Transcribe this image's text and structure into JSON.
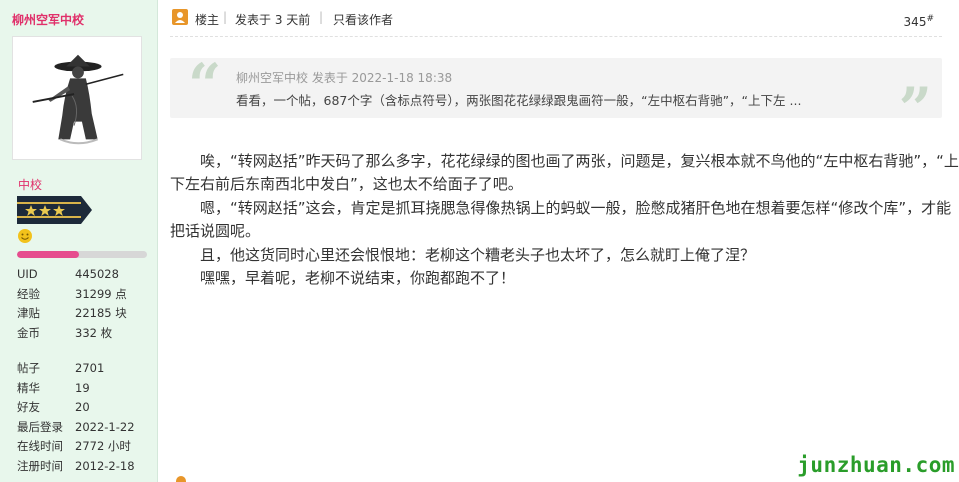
{
  "user": {
    "name": "柳州空军中校",
    "rank": "中校",
    "level_progress_percent": 48,
    "stats_group1": [
      {
        "label": "UID",
        "value": "445028"
      },
      {
        "label": "经验",
        "value": "31299 点"
      },
      {
        "label": "津贴",
        "value": "22185 块"
      },
      {
        "label": "金币",
        "value": "332 枚"
      }
    ],
    "stats_group2": [
      {
        "label": "帖子",
        "value": "2701"
      },
      {
        "label": "精华",
        "value": "19"
      },
      {
        "label": "好友",
        "value": "20"
      },
      {
        "label": "最后登录",
        "value": "2022-1-22"
      },
      {
        "label": "在线时间",
        "value": "2772 小时"
      },
      {
        "label": "注册时间",
        "value": "2012-2-18"
      }
    ]
  },
  "post": {
    "op_label": "楼主",
    "sep": "|",
    "time_label": "发表于 3 天前",
    "author_only_label": "只看该作者",
    "floor": "345",
    "floor_sup": "#",
    "quote": {
      "meta": "柳州空军中校 发表于 2022-1-18 18:38",
      "text": "看看，一个帖，687个字（含标点符号），两张图花花绿绿跟鬼画符一般，“左中枢右背驰”，“上下左 ...",
      "open_mark": "“",
      "close_mark": "”"
    },
    "paragraphs": [
      "唉，“转网赵括”昨天码了那么多字，花花绿绿的图也画了两张，问题是，复兴根本就不鸟他的“左中枢右背驰”，“上下左右前后东南西北中发白”，这也太不给面子了吧。",
      "嗯，“转网赵括”这会，肯定是抓耳挠腮急得像热锅上的蚂蚁一般，脸憋成猪肝色地在想着要怎样“修改个库”，才能把话说圆呢。",
      "且，他这货同时心里还会恨恨地：老柳这个糟老头子也太坏了，怎么就盯上俺了涅？",
      "嘿嘿，早着呢，老柳不说结束，你跑都跑不了！"
    ]
  },
  "watermark": "junzhuan.com",
  "colors": {
    "sidebar_bg": "#e8f7ec",
    "username": "#e0306a",
    "progress": "#e64d8e",
    "watermark": "#2a9d2a",
    "op_icon": "#e8962a"
  }
}
